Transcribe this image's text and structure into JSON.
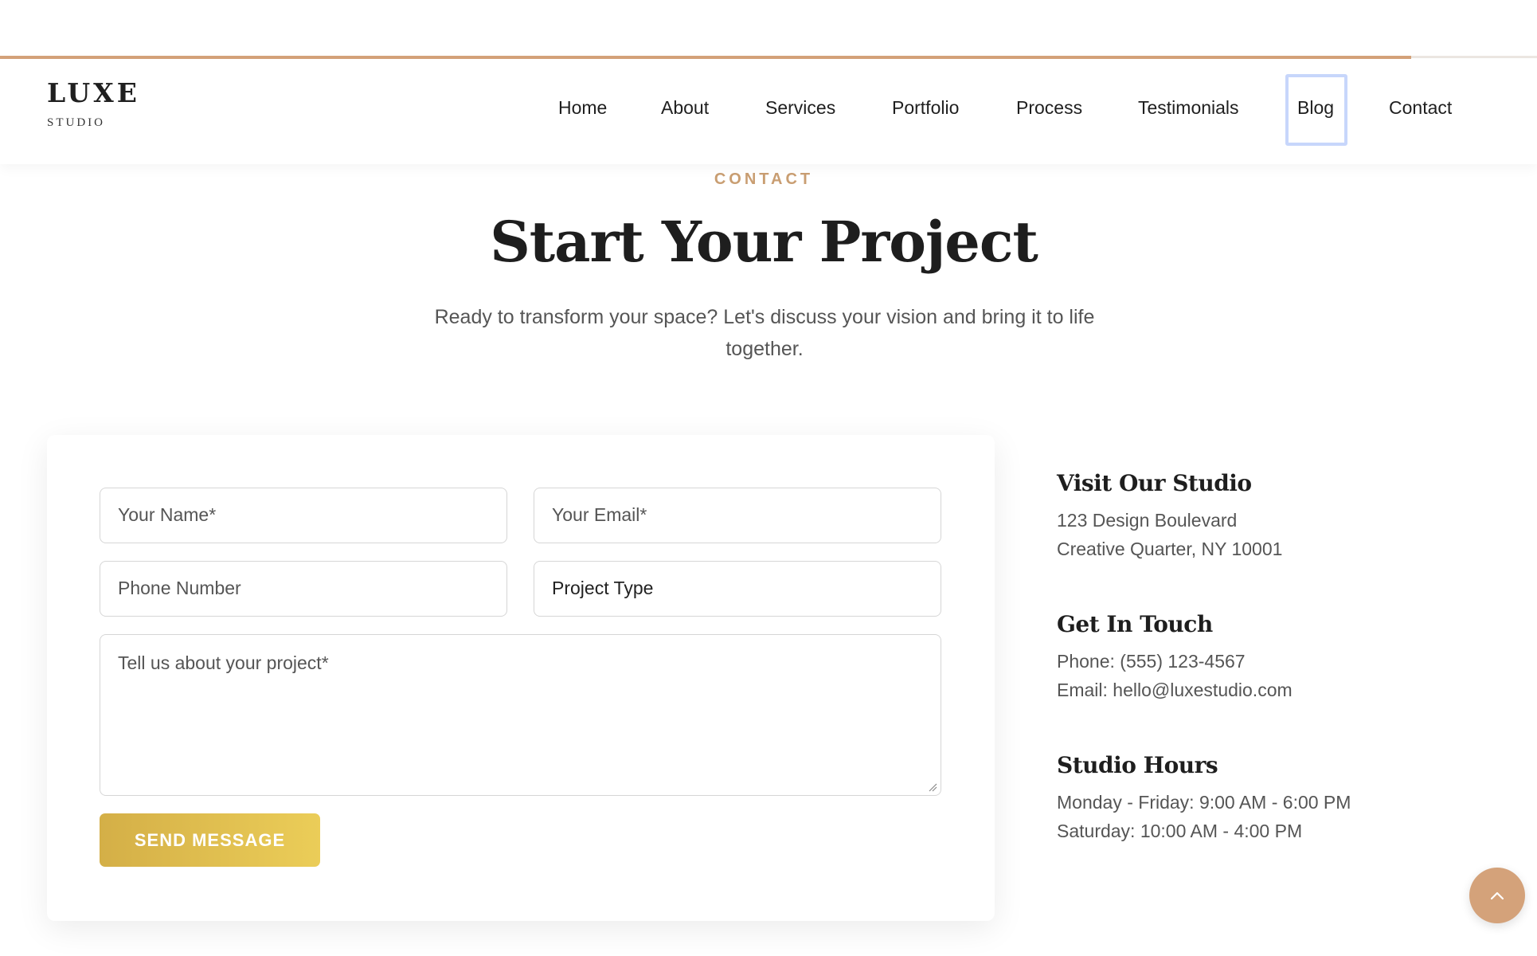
{
  "brand": {
    "name": "LUXE",
    "tagline": "STUDIO"
  },
  "nav": {
    "items": [
      {
        "label": "Home"
      },
      {
        "label": "About"
      },
      {
        "label": "Services"
      },
      {
        "label": "Portfolio"
      },
      {
        "label": "Process"
      },
      {
        "label": "Testimonials"
      },
      {
        "label": "Blog"
      },
      {
        "label": "Contact"
      }
    ],
    "focused_item": "Blog"
  },
  "page_progress": 0.918,
  "section": {
    "eyebrow": "CONTACT",
    "title": "Start Your Project",
    "subtitle": "Ready to transform your space? Let's discuss your vision and bring it to life together."
  },
  "form": {
    "name_placeholder": "Your Name*",
    "email_placeholder": "Your Email*",
    "phone_placeholder": "Phone Number",
    "project_type_value": "Project Type",
    "message_placeholder": "Tell us about your project*",
    "submit_label": "SEND MESSAGE"
  },
  "info": {
    "studio": {
      "title": "Visit Our Studio",
      "lines": [
        "123 Design Boulevard",
        "Creative Quarter, NY 10001"
      ]
    },
    "contact": {
      "title": "Get In Touch",
      "lines": [
        "Phone: (555) 123-4567",
        "Email: hello@luxestudio.com"
      ]
    },
    "hours": {
      "title": "Studio Hours",
      "lines": [
        "Monday - Friday: 9:00 AM - 6:00 PM",
        "Saturday: 10:00 AM - 4:00 PM"
      ]
    }
  },
  "colors": {
    "accent": "#d4a27a",
    "gold_button_start": "#d4af47",
    "gold_button_end": "#ebcd58",
    "focus_ring": "#c7d6fb"
  },
  "icons": {
    "scroll_top": "chevron-up-icon",
    "resize": "resize-grip-icon"
  }
}
